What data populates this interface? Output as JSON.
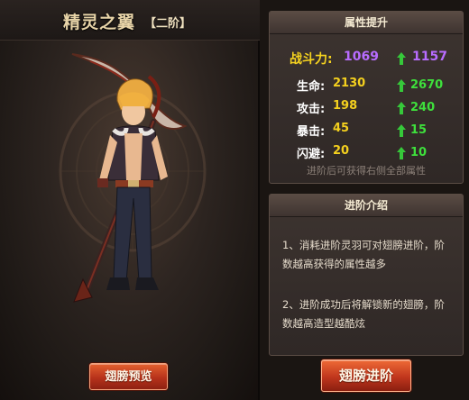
{
  "preview": {
    "title": "精灵之翼",
    "rank": "【二阶】",
    "preview_button": "翅膀预览"
  },
  "attributes": {
    "header": "属性提升",
    "power": {
      "label": "战斗力:",
      "current": "1069",
      "next": "1157"
    },
    "stats": [
      {
        "label": "生命:",
        "current": "2130",
        "next": "2670"
      },
      {
        "label": "攻击:",
        "current": "198",
        "next": "240"
      },
      {
        "label": "暴击:",
        "current": "45",
        "next": "15"
      },
      {
        "label": "闪避:",
        "current": "20",
        "next": "10"
      }
    ],
    "hint": "进阶后可获得右侧全部属性"
  },
  "intro": {
    "header": "进阶介绍",
    "line1a": "1、消耗进阶灵羽可对翅膀进阶，阶",
    "line1b": "数越高获得的属性越多",
    "line2a": "2、进阶成功后将解锁新的翅膀，阶",
    "line2b": "数越高造型越酷炫"
  },
  "advance_button": "翅膀进阶",
  "colors": {
    "power_label": "#f6d31f",
    "power_value": "#b86cff",
    "stat_value": "#f4d01e",
    "upgrade_value": "#3ee03c",
    "button": "#c0361d"
  }
}
